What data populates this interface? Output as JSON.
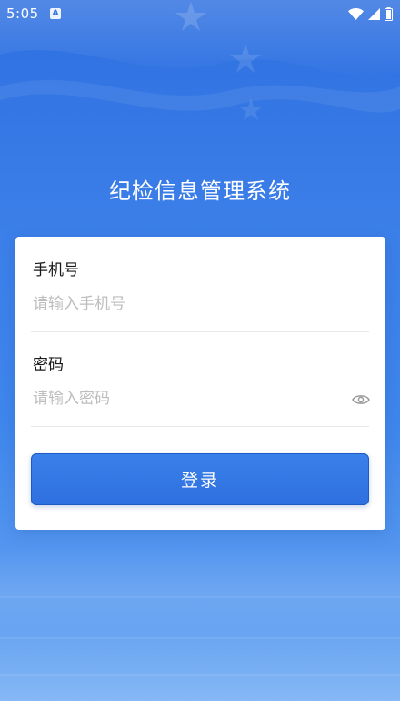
{
  "status_bar": {
    "time": "5:05",
    "a_icon": "A",
    "icons": [
      "wifi-icon",
      "signal-icon",
      "battery-icon"
    ]
  },
  "app": {
    "title": "纪检信息管理系统"
  },
  "login_form": {
    "phone": {
      "label": "手机号",
      "placeholder": "请输入手机号",
      "value": ""
    },
    "password": {
      "label": "密码",
      "placeholder": "请输入密码",
      "value": "",
      "toggle_icon": "eye-icon"
    },
    "submit_label": "登录"
  },
  "colors": {
    "background_top": "#2d6fe0",
    "background_bottom": "#6aa8f2",
    "button": "#2e70df",
    "placeholder": "#bdbdbd"
  }
}
